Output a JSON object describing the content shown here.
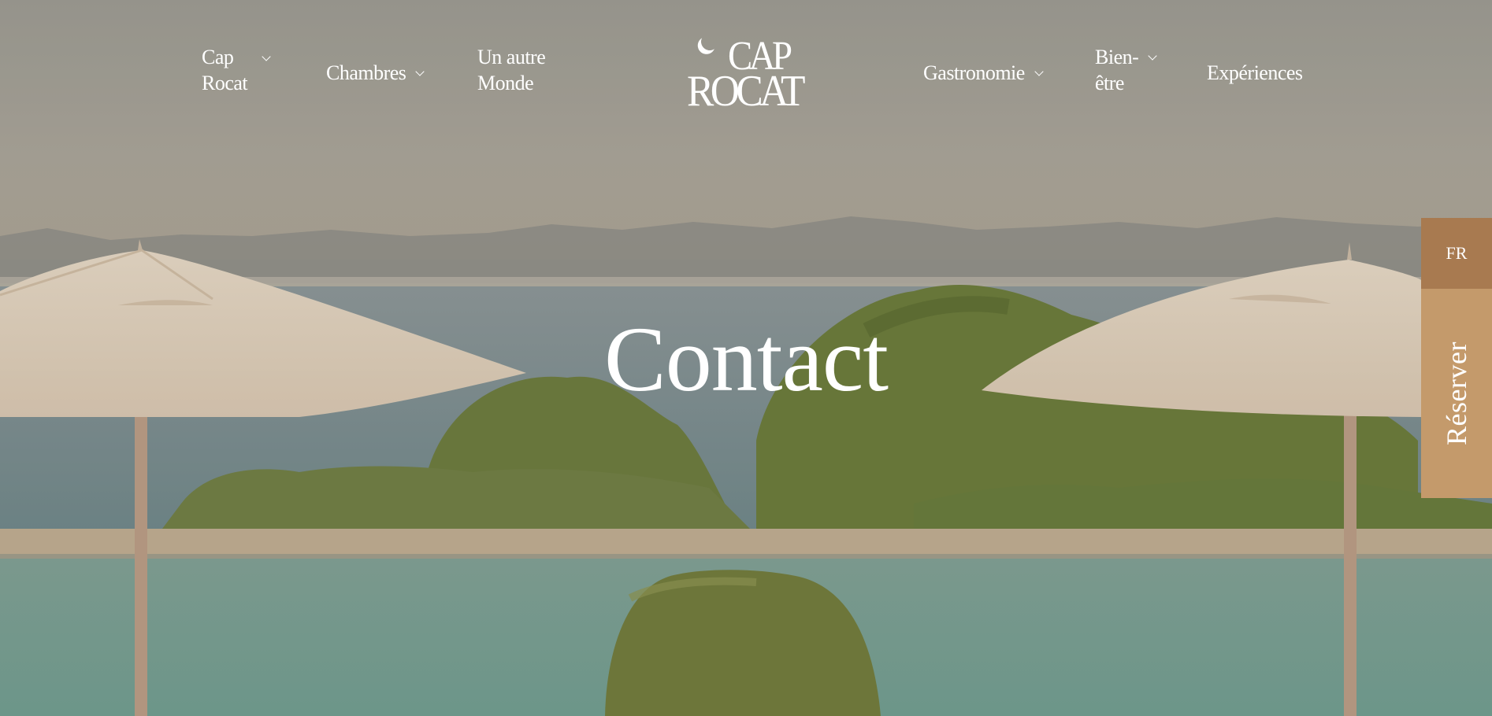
{
  "nav": {
    "left_items": [
      {
        "label_line1": "Cap",
        "label_line2": "Rocat",
        "has_dropdown": true
      },
      {
        "label": "Chambres",
        "has_dropdown": true
      },
      {
        "label_line1": "Un autre",
        "label_line2": "Monde",
        "has_dropdown": false
      }
    ],
    "right_items": [
      {
        "label": "Gastronomie",
        "has_dropdown": true
      },
      {
        "label_line1": "Bien-",
        "label_line2": "être",
        "has_dropdown": true
      },
      {
        "label": "Expériences",
        "has_dropdown": false
      }
    ]
  },
  "logo": {
    "line1": "CAP",
    "line2": "ROCAT"
  },
  "hero": {
    "title": "Contact"
  },
  "side_panel": {
    "language": "FR",
    "reserve_label": "Réserver"
  },
  "colors": {
    "lang_bg": "#a87a50",
    "reserve_bg": "#c49a6b",
    "text": "#ffffff"
  }
}
